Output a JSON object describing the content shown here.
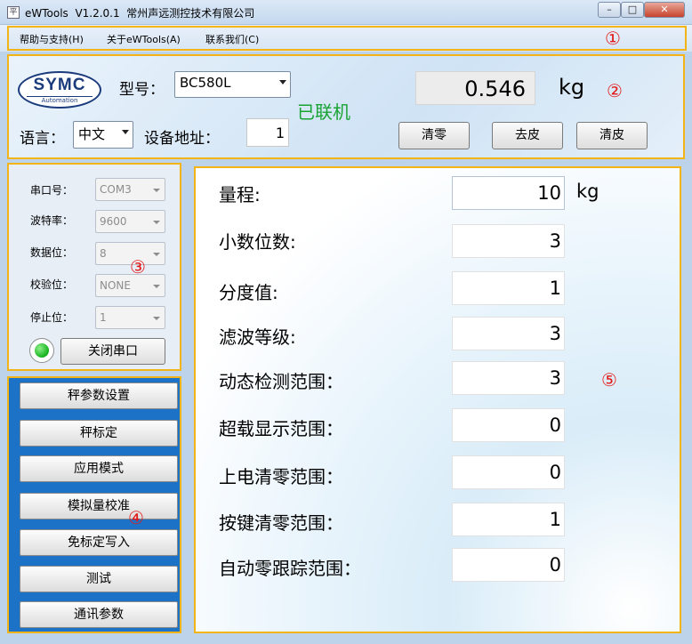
{
  "window": {
    "icon_text": "平",
    "title": "eWTools  V1.2.0.1  常州声远测控技术有限公司",
    "min_symbol": "–",
    "max_symbol": "□",
    "close_symbol": "✕"
  },
  "menu": {
    "help": "帮助与支持(H)",
    "about": "关于eWTools(A)",
    "contact": "联系我们(C)"
  },
  "header": {
    "logo_main": "SYMC",
    "logo_sub": "Automation",
    "model_label": "型号：",
    "model_value": "BC580L",
    "status": "已联机",
    "weight": "0.546",
    "weight_unit": "kg",
    "language_label": "语言：",
    "language_value": "中文",
    "address_label": "设备地址：",
    "address_value": "1",
    "btn_zero": "清零",
    "btn_tare": "去皮",
    "btn_clear_tare": "清皮"
  },
  "serial": {
    "port_label": "串口号：",
    "port_value": "COM3",
    "baud_label": "波特率：",
    "baud_value": "9600",
    "databits_label": "数据位：",
    "databits_value": "8",
    "parity_label": "校验位：",
    "parity_value": "NONE",
    "stopbits_label": "停止位：",
    "stopbits_value": "1",
    "close_port": "关闭串口",
    "led_color": "#14b11d"
  },
  "nav": {
    "items": [
      "秤参数设置",
      "秤标定",
      "应用模式",
      "模拟量校准",
      "免标定写入",
      "测试",
      "通讯参数"
    ]
  },
  "params": {
    "range_label": "量程:",
    "range_value": "10",
    "range_unit": "kg",
    "decimals_label": "小数位数:",
    "decimals_value": "3",
    "division_label": "分度值:",
    "division_value": "1",
    "filter_label": "滤波等级:",
    "filter_value": "3",
    "motion_label": "动态检测范围：",
    "motion_value": "3",
    "overload_label": "超载显示范围：",
    "overload_value": "0",
    "powerzero_label": "上电清零范围：",
    "powerzero_value": "0",
    "keyzero_label": "按键清零范围：",
    "keyzero_value": "1",
    "autozero_label": "自动零跟踪范围：",
    "autozero_value": "0"
  },
  "badges": {
    "b1": "①",
    "b2": "②",
    "b3": "③",
    "b4": "④",
    "b5": "⑤"
  }
}
